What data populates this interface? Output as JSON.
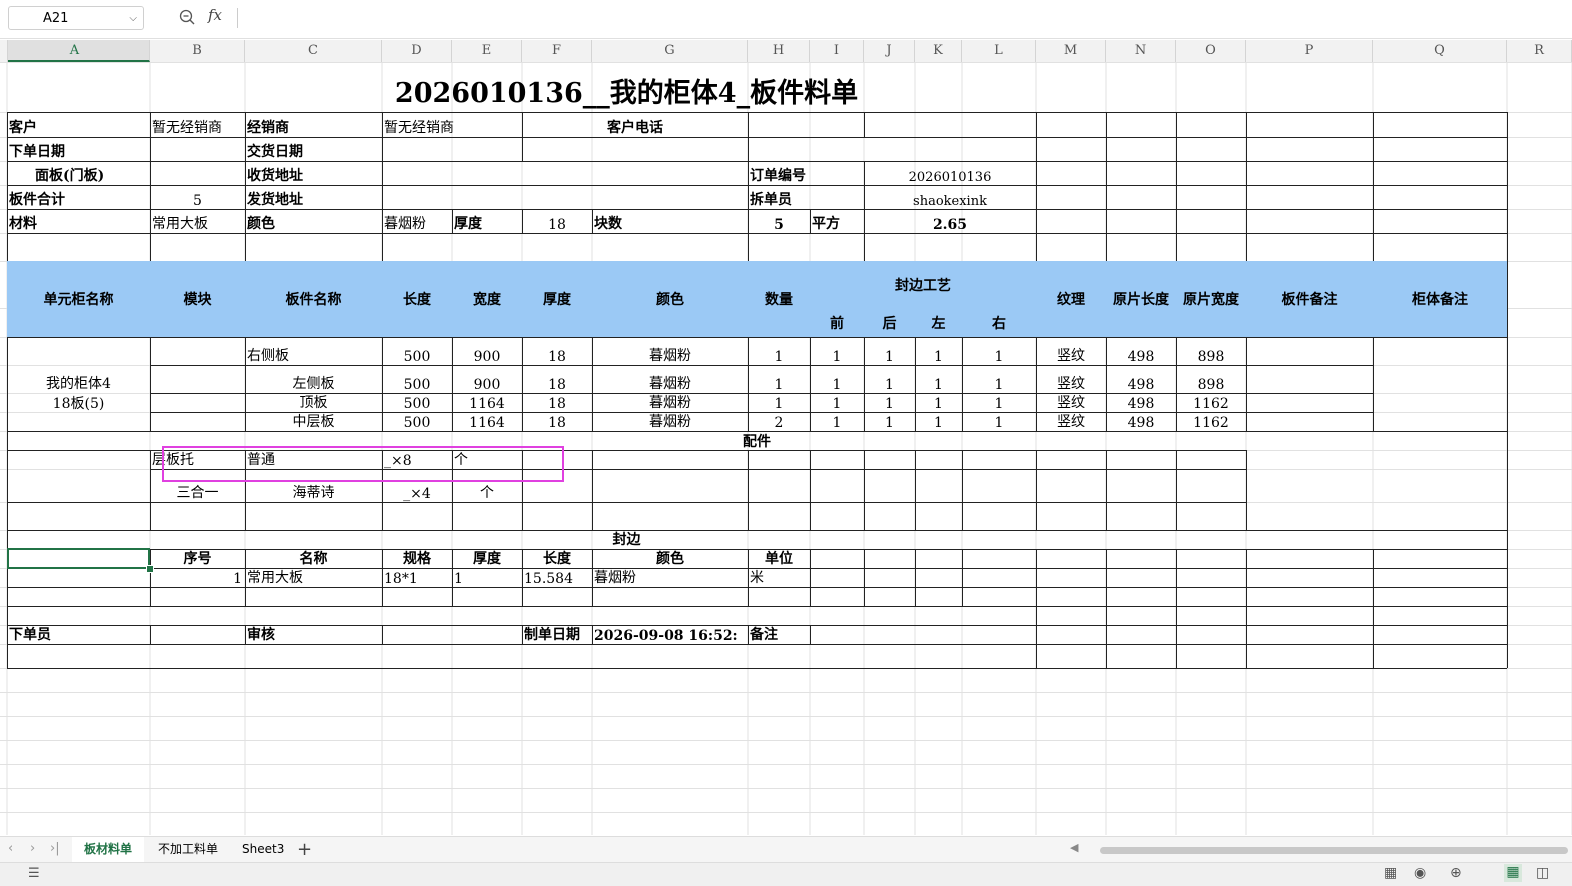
{
  "formula_bar": {
    "cell_ref": "A21",
    "fx_label": "fx"
  },
  "columns": [
    "A",
    "B",
    "C",
    "D",
    "E",
    "F",
    "G",
    "H",
    "I",
    "J",
    "K",
    "L",
    "M",
    "N",
    "O",
    "P",
    "Q",
    "R"
  ],
  "title": "2026010136__我的柜体4_板件料单",
  "info": {
    "customer_label": "客户",
    "customer_value": "暂无经销商",
    "dealer_label": "经销商",
    "dealer_value": "暂无经销商",
    "phone_label": "客户电话",
    "order_date_label": "下单日期",
    "delivery_date_label": "交货日期",
    "panel_label": "面板(门板)",
    "receive_addr_label": "收货地址",
    "order_no_label": "订单编号",
    "order_no_value": "2026010136",
    "board_total_label": "板件合计",
    "board_total_value": "5",
    "ship_addr_label": "发货地址",
    "splitter_label": "拆单员",
    "splitter_value": "shaokexink",
    "material_label": "材料",
    "material_value": "常用大板",
    "color_label": "颜色",
    "color_value": "暮烟粉",
    "thickness_label": "厚度",
    "thickness_value": "18",
    "pieces_label": "块数",
    "pieces_value": "5",
    "area_label": "平方",
    "area_value": "2.65"
  },
  "table_headers": {
    "unit_name": "单元柜名称",
    "module": "模块",
    "board_name": "板件名称",
    "length": "长度",
    "width": "宽度",
    "thickness": "厚度",
    "color": "颜色",
    "qty": "数量",
    "edge_group": "封边工艺",
    "front": "前",
    "back": "后",
    "left": "左",
    "right": "右",
    "grain": "纹理",
    "raw_length": "原片长度",
    "raw_width": "原片宽度",
    "board_note": "板件备注",
    "cabinet_note": "柜体备注"
  },
  "cabinet": {
    "name_line1": "我的柜体4",
    "name_line2": "18板(5)"
  },
  "boards": [
    {
      "name": "右侧板",
      "length": "500",
      "width": "900",
      "thickness": "18",
      "color": "暮烟粉",
      "qty": "1",
      "front": "1",
      "back": "1",
      "left": "1",
      "right": "1",
      "grain": "竖纹",
      "raw_length": "498",
      "raw_width": "898"
    },
    {
      "name": "左侧板",
      "length": "500",
      "width": "900",
      "thickness": "18",
      "color": "暮烟粉",
      "qty": "1",
      "front": "1",
      "back": "1",
      "left": "1",
      "right": "1",
      "grain": "竖纹",
      "raw_length": "498",
      "raw_width": "898"
    },
    {
      "name": "顶板",
      "length": "500",
      "width": "1164",
      "thickness": "18",
      "color": "暮烟粉",
      "qty": "1",
      "front": "1",
      "back": "1",
      "left": "1",
      "right": "1",
      "grain": "竖纹",
      "raw_length": "498",
      "raw_width": "1162"
    },
    {
      "name": "中层板",
      "length": "500",
      "width": "1164",
      "thickness": "18",
      "color": "暮烟粉",
      "qty": "2",
      "front": "1",
      "back": "1",
      "left": "1",
      "right": "1",
      "grain": "竖纹",
      "raw_length": "498",
      "raw_width": "1162"
    }
  ],
  "accessories": {
    "title": "配件",
    "rows": [
      {
        "name": "层板托",
        "type": "普通",
        "qty": "_×8",
        "unit": "个"
      },
      {
        "name": "三合一",
        "type": "海蒂诗",
        "qty": "_×4",
        "unit": "个"
      }
    ]
  },
  "edge": {
    "title": "封边",
    "headers": {
      "seq": "序号",
      "name": "名称",
      "spec": "规格",
      "thickness": "厚度",
      "length": "长度",
      "color": "颜色",
      "unit": "单位"
    },
    "row": {
      "seq": "1",
      "name": "常用大板",
      "spec": "18*1",
      "thickness": "1",
      "length": "15.584",
      "color": "暮烟粉",
      "unit": "米"
    }
  },
  "footer": {
    "orderer_label": "下单员",
    "review_label": "审核",
    "made_date_label": "制单日期",
    "made_date_value": "2026-09-08 16:52:",
    "remark_label": "备注"
  },
  "sheet_tabs": [
    "板材料单",
    "不加工料单",
    "Sheet3"
  ],
  "active_tab": "板材料单",
  "colors": {
    "header_fill": "#9bc9f5",
    "selection": "#217346",
    "highlight_box": "#e040e0"
  }
}
